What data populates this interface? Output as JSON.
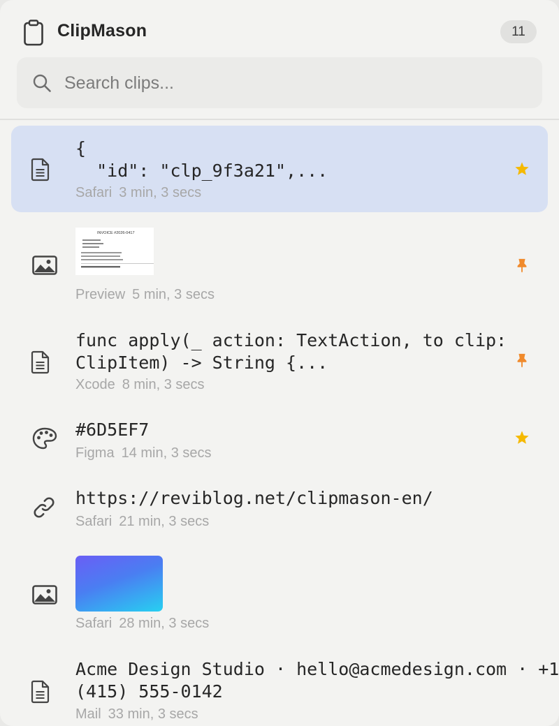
{
  "app": {
    "title": "ClipMason",
    "count": "11"
  },
  "search": {
    "placeholder": "Search clips..."
  },
  "colors": {
    "selected_row": "#d7e0f3",
    "star": "#f5b900",
    "pin": "#f08a2c",
    "gradient_start": "#6a5ef5",
    "gradient_end": "#27d0f1"
  },
  "clips": [
    {
      "type_icon": "document-icon",
      "text": "{\n  \"id\": \"clp_9f3a21\",...",
      "app": "Safari",
      "time": "3 min, 3 secs",
      "badge": "star-icon",
      "selected": true
    },
    {
      "type_icon": "image-icon",
      "thumbnail": "invoice-thumbnail",
      "thumbnail_text": "INVOICE #2026-0417",
      "app": "Preview",
      "time": "5 min, 3 secs",
      "badge": "pin-icon"
    },
    {
      "type_icon": "document-icon",
      "text": "func apply(_ action: TextAction, to clip:\nClipItem) -> String {...",
      "app": "Xcode",
      "time": "8 min, 3 secs",
      "badge": "pin-icon"
    },
    {
      "type_icon": "palette-icon",
      "text": "#6D5EF7",
      "app": "Figma",
      "time": "14 min, 3 secs",
      "badge": "star-icon"
    },
    {
      "type_icon": "link-icon",
      "text": "https://reviblog.net/clipmason-en/",
      "app": "Safari",
      "time": "21 min, 3 secs"
    },
    {
      "type_icon": "image-icon",
      "thumbnail": "gradient-thumbnail",
      "app": "Safari",
      "time": "28 min, 3 secs"
    },
    {
      "type_icon": "document-icon",
      "text": "Acme Design Studio · hello@acmedesign.com · +1\n(415) 555-0142",
      "app": "Mail",
      "time": "33 min, 3 secs"
    }
  ]
}
